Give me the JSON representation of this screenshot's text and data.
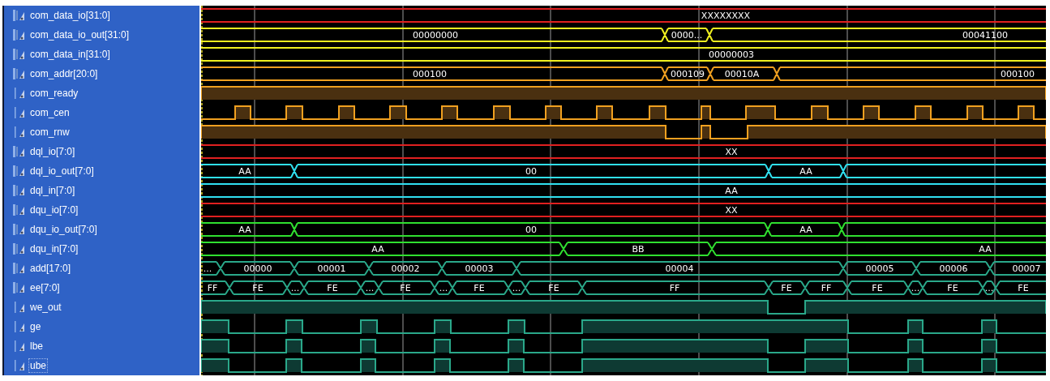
{
  "signals": [
    {
      "name": "com_data_io[31:0]",
      "kind": "bus",
      "color": "#e02020",
      "selected": false,
      "values": [
        "XXXXXXXX"
      ]
    },
    {
      "name": "com_data_io_out[31:0]",
      "kind": "bus",
      "color": "#f0f020",
      "selected": false,
      "values": [
        "00000000",
        "0000...",
        "00041100"
      ]
    },
    {
      "name": "com_data_in[31:0]",
      "kind": "bus",
      "color": "#f0f020",
      "selected": false,
      "values": [
        "00000003"
      ]
    },
    {
      "name": "com_addr[20:0]",
      "kind": "bus",
      "color": "#f0a020",
      "selected": false,
      "values": [
        "000100",
        "000109",
        "00010A",
        "000100"
      ]
    },
    {
      "name": "com_ready",
      "kind": "bit",
      "color": "#f0a020",
      "selected": false
    },
    {
      "name": "com_cen",
      "kind": "bit",
      "color": "#f0a020",
      "selected": false
    },
    {
      "name": "com_rnw",
      "kind": "bit",
      "color": "#f0a020",
      "selected": false
    },
    {
      "name": "dql_io[7:0]",
      "kind": "bus",
      "color": "#e02020",
      "selected": false,
      "values": [
        "XX"
      ]
    },
    {
      "name": "dql_io_out[7:0]",
      "kind": "bus",
      "color": "#30e0f0",
      "selected": false,
      "values": [
        "AA",
        "00",
        "AA"
      ]
    },
    {
      "name": "dql_in[7:0]",
      "kind": "bus",
      "color": "#30e0f0",
      "selected": false,
      "values": [
        "AA"
      ]
    },
    {
      "name": "dqu_io[7:0]",
      "kind": "bus",
      "color": "#e02020",
      "selected": false,
      "values": [
        "XX"
      ]
    },
    {
      "name": "dqu_io_out[7:0]",
      "kind": "bus",
      "color": "#30e030",
      "selected": false,
      "values": [
        "AA",
        "00",
        "AA"
      ]
    },
    {
      "name": "dqu_in[7:0]",
      "kind": "bus",
      "color": "#30e030",
      "selected": false,
      "values": [
        "AA",
        "BB",
        "AA"
      ]
    },
    {
      "name": "add[17:0]",
      "kind": "bus",
      "color": "#2aa88a",
      "selected": false,
      "values": [
        "...",
        "00000",
        "00001",
        "00002",
        "00003",
        "00004",
        "00005",
        "00006",
        "00007"
      ]
    },
    {
      "name": "ee[7:0]",
      "kind": "bus",
      "color": "#2aa88a",
      "selected": false,
      "values": [
        "FF",
        "FE",
        "...",
        "FE",
        "...",
        "FE",
        "...",
        "FE",
        "...",
        "FE",
        "FF",
        "FE",
        "FF",
        "FE",
        "...",
        "FE",
        "...",
        "FE"
      ]
    },
    {
      "name": "we_out",
      "kind": "bit",
      "color": "#2aa88a",
      "selected": false
    },
    {
      "name": "ge",
      "kind": "bit",
      "color": "#2aa88a",
      "selected": false
    },
    {
      "name": "lbe",
      "kind": "bit",
      "color": "#2aa88a",
      "selected": false
    },
    {
      "name": "ube",
      "kind": "bit",
      "color": "#2aa88a",
      "selected": true
    }
  ]
}
